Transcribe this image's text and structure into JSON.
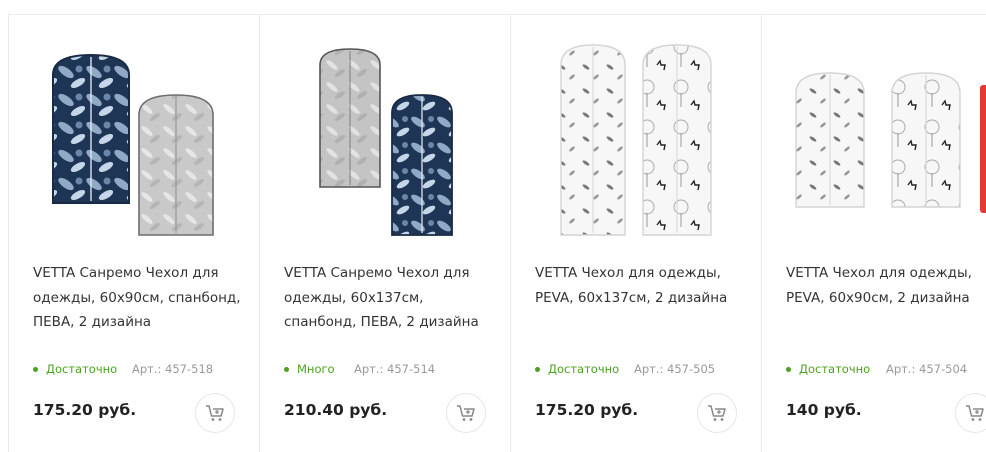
{
  "products": [
    {
      "title": "VETTA Санремо Чехол для одежды, 60х90см, спанбонд, ПЕВА, 2 дизайна",
      "stock": "Достаточно",
      "article": "Арт.: 457-518",
      "price": "175.20 руб.",
      "image": "garment-covers-blue-floral-and-gray"
    },
    {
      "title": "VETTA Санремо Чехол для одежды, 60х137см, спанбонд, ПЕВА, 2 дизайна",
      "stock": "Много",
      "article": "Арт.: 457-514",
      "price": "210.40 руб.",
      "image": "garment-covers-gray-and-blue-floral"
    },
    {
      "title": "VETTA Чехол для одежды, PEVA, 60х137см, 2 дизайна",
      "stock": "Достаточно",
      "article": "Арт.: 457-505",
      "price": "175.20 руб.",
      "image": "garment-covers-white-leaves-and-deer"
    },
    {
      "title": "VETTA Чехол для одежды, PEVA, 60х90см, 2 дизайна",
      "stock": "Достаточно",
      "article": "Арт.: 457-504",
      "price": "140 руб.",
      "image": "garment-covers-white-leaves-and-deer-short"
    }
  ],
  "colors": {
    "stock_green": "#4ca122",
    "accent_red": "#e53935",
    "cart_icon": "#888888"
  },
  "icons": {
    "cart": "cart-plus-icon"
  }
}
